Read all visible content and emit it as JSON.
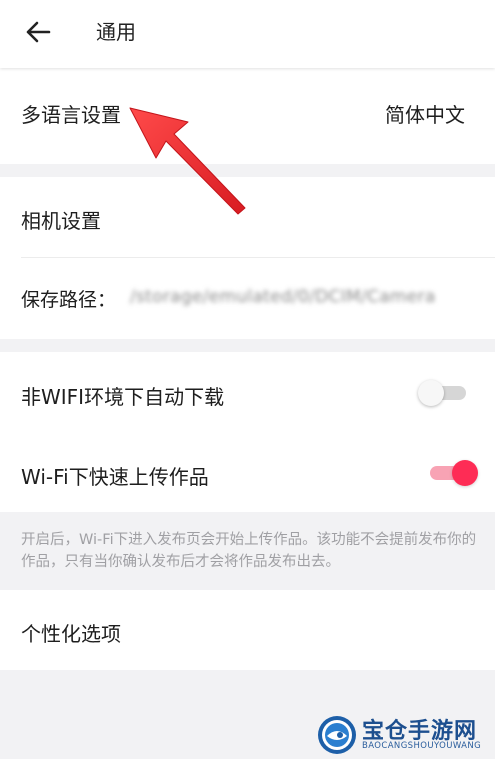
{
  "header": {
    "title": "通用",
    "back_icon": "arrow-left-icon"
  },
  "language": {
    "label": "多语言设置",
    "value": "简体中文"
  },
  "camera": {
    "label": "相机设置",
    "save_path_label": "保存路径：",
    "save_path_value": "/storage/emulated/0/DCIM/Camera"
  },
  "downloads": {
    "auto_download_label": "非WIFI环境下自动下载",
    "auto_download_on": false,
    "fast_upload_label": "Wi-Fi下快速上传作品",
    "fast_upload_on": true,
    "note": "开启后，Wi-Fi下进入发布页会开始上传作品。该功能不会提前发布你的作品，只有当你确认发布后才会将作品发布出去。"
  },
  "personalize": {
    "label": "个性化选项"
  },
  "watermark": {
    "title": "宝仓手游网",
    "subtitle": "BAOCANGSHOUYOUWANG"
  },
  "colors": {
    "accent": "#fe2c55",
    "accent_light": "#f8a3b4",
    "arrow": "#e8262c",
    "background": "#f2f2f4"
  }
}
